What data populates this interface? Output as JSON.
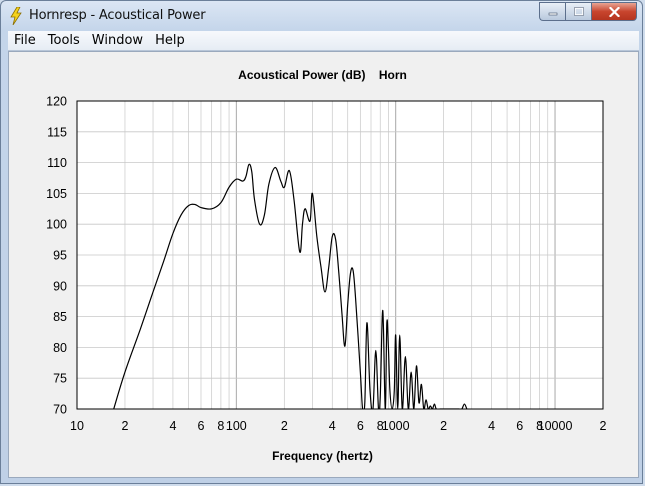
{
  "window": {
    "title": "Hornresp - Acoustical Power",
    "menu": [
      "File",
      "Tools",
      "Window",
      "Help"
    ]
  },
  "colors": {
    "plot_bg": "#ffffff",
    "grid": "#c8c8c8",
    "curve": "#000000"
  },
  "chart_data": {
    "type": "line",
    "title": "Acoustical Power (dB)    Horn",
    "xlabel": "Frequency (hertz)",
    "ylabel": "",
    "xscale": "log",
    "xlim": [
      10,
      20000
    ],
    "ylim": [
      70,
      120
    ],
    "grid": true,
    "yticks": [
      70,
      75,
      80,
      85,
      90,
      95,
      100,
      105,
      110,
      115,
      120
    ],
    "yticklabels": [
      "70",
      "75",
      "80",
      "85",
      "90",
      "95",
      "100",
      "105",
      "110",
      "115",
      "120"
    ],
    "xticks": [
      10,
      20,
      40,
      60,
      80,
      100,
      200,
      400,
      600,
      800,
      1000,
      2000,
      4000,
      6000,
      8000,
      10000,
      20000
    ],
    "xticklabels": [
      "10",
      "2",
      "4",
      "6",
      "8",
      "100",
      "2",
      "4",
      "6",
      "8",
      "1000",
      "2",
      "4",
      "6",
      "8",
      "10000",
      "2"
    ],
    "series": [
      {
        "x": [
          17,
          20,
          25,
          30,
          35,
          40,
          45,
          50,
          55,
          60,
          70,
          80,
          90,
          100,
          110,
          115,
          120,
          125,
          130,
          140,
          150,
          160,
          175,
          190,
          200,
          215,
          230,
          250,
          260,
          270,
          290,
          300,
          320,
          340,
          360,
          380,
          400,
          420,
          440,
          460,
          480,
          500,
          520,
          540,
          560,
          600,
          620,
          640,
          660,
          690,
          720,
          750,
          780,
          800,
          830,
          860,
          880,
          900,
          920,
          950,
          980,
          1000,
          1030,
          1060,
          1100,
          1150,
          1200,
          1250,
          1300,
          1350,
          1400,
          1450,
          1500,
          1550,
          1600,
          1650,
          1700,
          1750,
          1800,
          1900,
          2000,
          2050,
          2100,
          2200,
          2300,
          2400,
          2500,
          2600,
          2700,
          2800,
          2850
        ],
        "y": [
          70,
          76,
          83,
          89,
          94,
          98.5,
          101.5,
          103,
          103.2,
          102.7,
          102.5,
          103.5,
          106,
          107.3,
          107,
          107.8,
          109.7,
          108.5,
          104,
          100,
          101.5,
          106.5,
          109.2,
          107,
          106,
          108.7,
          104,
          95.5,
          100,
          102.5,
          100.5,
          105,
          98,
          93,
          89,
          93,
          98,
          97.5,
          92,
          85.5,
          80.2,
          87,
          92,
          92.5,
          88,
          76,
          70,
          71,
          84,
          73,
          70,
          79.5,
          70,
          72,
          86,
          70,
          84,
          80,
          73,
          70,
          73,
          82,
          70,
          82,
          70,
          78.5,
          70,
          76,
          70,
          77,
          71,
          74,
          70,
          71.5,
          70,
          70.5,
          70,
          70.8,
          70,
          70,
          70,
          70,
          70,
          70,
          70,
          70,
          70,
          70,
          70.8,
          70,
          70
        ]
      }
    ]
  }
}
